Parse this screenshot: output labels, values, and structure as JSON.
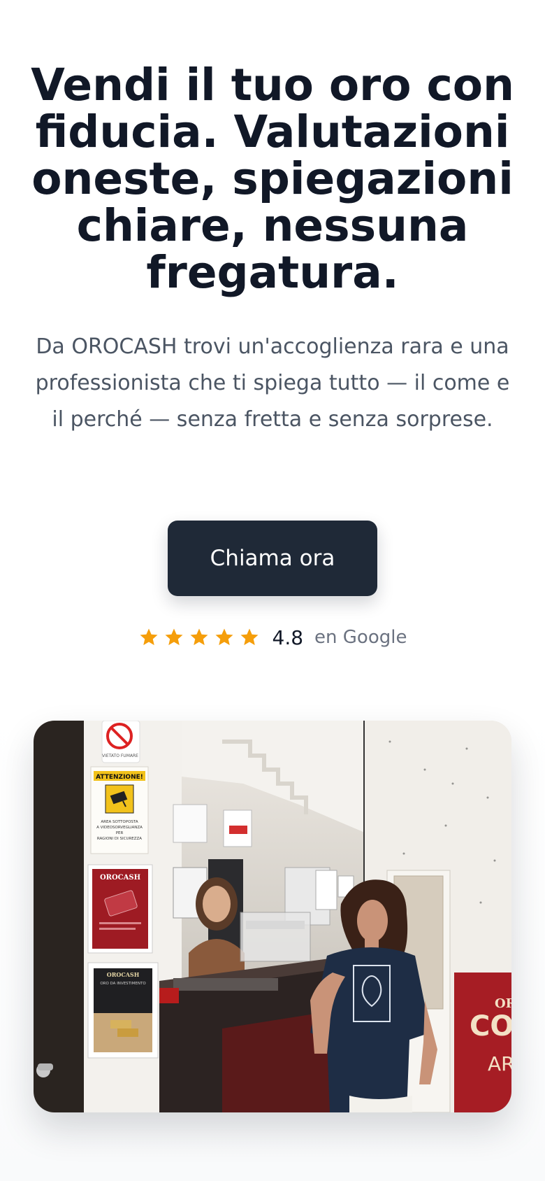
{
  "hero": {
    "title": "Vendi il tuo oro con fiducia. Valutazioni oneste, spiegazioni chiare, nessuna fregatura.",
    "subtitle": "Da OROCASH trovi un'accoglienza rara e una professionista che ti spiega tutto — il come e il perché — senza fretta e senza sorprese."
  },
  "cta": {
    "label": "Chiama ora"
  },
  "rating": {
    "stars": 5,
    "value": "4.8",
    "source": "en Google",
    "star_color": "#f59e0b"
  },
  "photo": {
    "signs": {
      "no_smoking": "VIETATO FUMARE",
      "attention": "ATTENZIONE!",
      "video": "AREA SOTTOPOSTA A VIDEOSORVEGLIANZA PER RAGIONI DI SICUREZZA",
      "poster_brand": "OROCASH",
      "poster2_brand": "OROCASH",
      "poster2_text": "ORO DA INVESTIMENTO",
      "right_sign": "ORO CON AR"
    }
  },
  "colors": {
    "title": "#111827",
    "subtitle": "#4b5563",
    "button_bg": "#1f2937",
    "button_text": "#ffffff"
  }
}
